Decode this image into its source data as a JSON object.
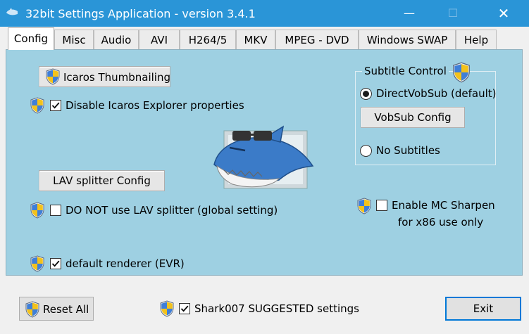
{
  "window": {
    "title": "32bit Settings Application - version 3.4.1",
    "controls": {
      "minimize": "—",
      "maximize": "☐",
      "close": "✕"
    }
  },
  "tabs": [
    {
      "label": "Config",
      "active": true
    },
    {
      "label": "Misc"
    },
    {
      "label": "Audio"
    },
    {
      "label": "AVI"
    },
    {
      "label": "H264/5"
    },
    {
      "label": "MKV"
    },
    {
      "label": "MPEG - DVD"
    },
    {
      "label": "Windows SWAP"
    },
    {
      "label": "Help"
    }
  ],
  "config": {
    "icaros_button": "Icaros Thumbnailing",
    "disable_icaros": {
      "label": "Disable Icaros Explorer properties",
      "checked": true
    },
    "lav_button": "LAV splitter Config",
    "no_lav": {
      "label": "DO NOT use LAV splitter (global setting)",
      "checked": false
    },
    "renderer": {
      "label": "default renderer (EVR)",
      "checked": true
    },
    "subtitle": {
      "title": "Subtitle Control",
      "directvobsub": {
        "label": "DirectVobSub (default)",
        "selected": true
      },
      "vobsub_button": "VobSub Config",
      "no_subtitles": {
        "label": "No Subtitles",
        "selected": false
      }
    },
    "mc_sharpen": {
      "label_line1": "Enable MC Sharpen",
      "label_line2": "for x86 use only",
      "checked": false
    }
  },
  "footer": {
    "reset_button": "Reset All",
    "suggested": {
      "label": "Shark007 SUGGESTED settings",
      "checked": true
    },
    "exit_button": "Exit"
  },
  "colors": {
    "titlebar": "#2a95d7",
    "panel": "#9ed0e2",
    "window": "#f0f0f0",
    "focus": "#0078d7"
  },
  "icons": [
    "shark-app-icon",
    "uac-shield-icon",
    "shark-logo-icon"
  ]
}
